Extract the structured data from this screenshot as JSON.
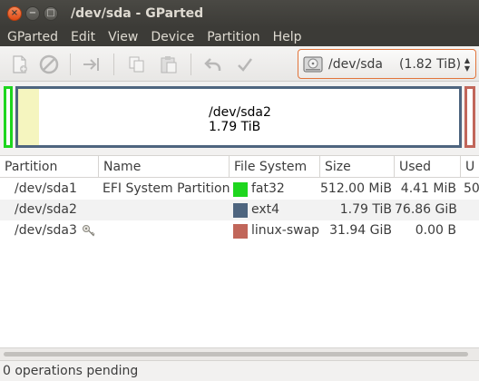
{
  "window": {
    "title": "/dev/sda - GParted",
    "close_glyph": "×",
    "minimize_glyph": "−",
    "maximize_glyph": "□"
  },
  "menubar": {
    "items": [
      "GParted",
      "Edit",
      "View",
      "Device",
      "Partition",
      "Help"
    ]
  },
  "toolbar": {
    "buttons": [
      "new-icon",
      "delete-icon",
      "resize-move-icon",
      "copy-icon",
      "paste-icon",
      "undo-icon",
      "apply-icon"
    ],
    "enabled": false
  },
  "device": {
    "name": "/dev/sda",
    "size": "(1.82 TiB)",
    "icon": "harddisk-icon",
    "accent": "#e2743a"
  },
  "diskmap": {
    "main_label": "/dev/sda2",
    "main_size": "1.79 TiB",
    "colors": {
      "fat32": "#1ed61e",
      "ext4": "#4e657f",
      "linux-swap": "#c1665a",
      "used": "#f5f5bf"
    }
  },
  "table": {
    "columns": [
      "Partition",
      "Name",
      "File System",
      "Size",
      "Used",
      "U"
    ],
    "rows": [
      {
        "partition": "/dev/sda1",
        "name": "EFI System Partition",
        "fs": "fat32",
        "fs_color": "#1ed61e",
        "size": "512.00 MiB",
        "used": "4.41 MiB",
        "unused": "50",
        "locked": false
      },
      {
        "partition": "/dev/sda2",
        "name": "",
        "fs": "ext4",
        "fs_color": "#4e657f",
        "size": "1.79 TiB",
        "used": "76.86 GiB",
        "unused": "",
        "locked": false
      },
      {
        "partition": "/dev/sda3",
        "name": "",
        "fs": "linux-swap",
        "fs_color": "#c1665a",
        "size": "31.94 GiB",
        "used": "0.00 B",
        "unused": "",
        "locked": true
      }
    ]
  },
  "status": {
    "text": "0 operations pending"
  }
}
